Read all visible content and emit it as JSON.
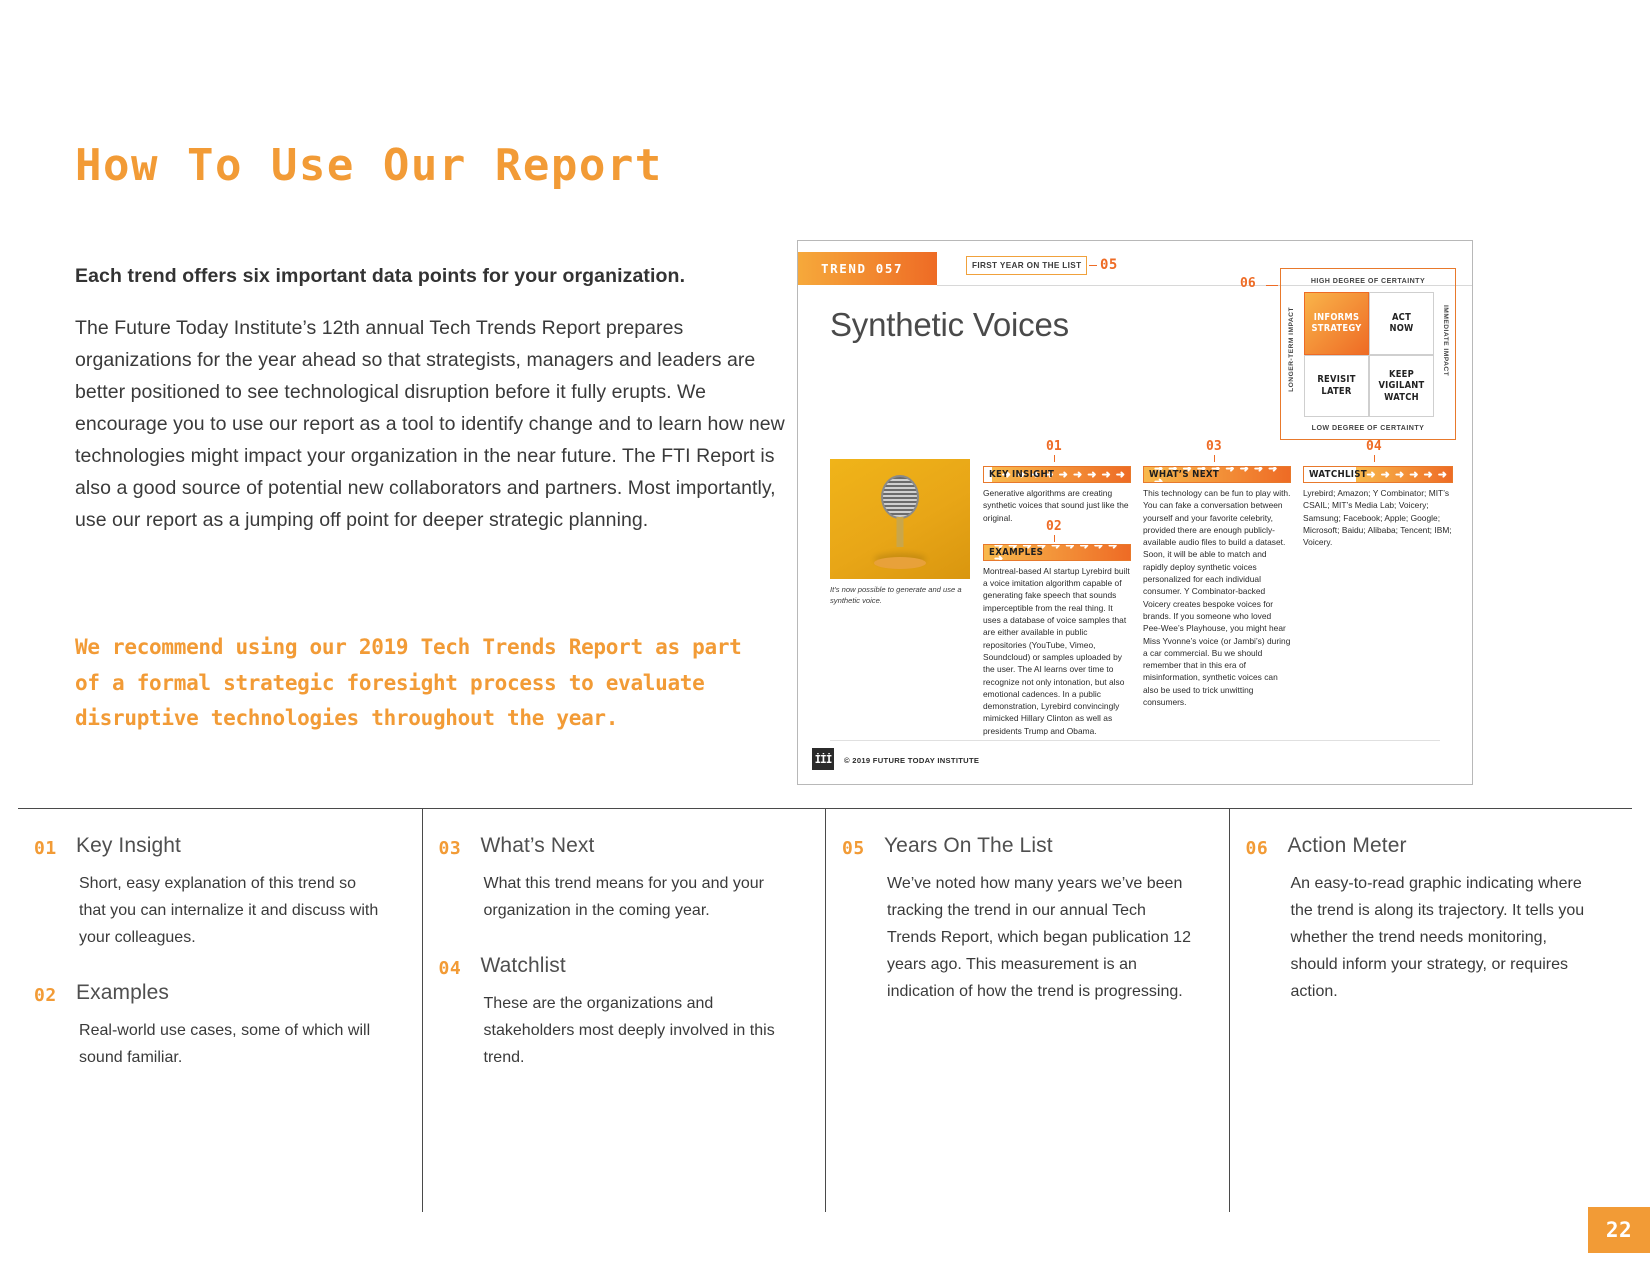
{
  "page": {
    "title": "How To Use Our Report",
    "number": "22",
    "accent_orange": "#F29B36",
    "accent_deep_orange": "#EE6B25"
  },
  "intro": {
    "lead": "Each trend offers six important data points for your organization.",
    "body": "The Future Today Institute’s 12th annual Tech Trends Report prepares organizations for the year ahead so that strategists, managers and leaders are better positioned to see technological disruption before it fully erupts. We encourage you to use our report as a tool to identify change and to learn how new technologies might impact your organization in the near future. The FTI Report is also a good source of potential new collaborators and partners. Most importantly, use our report as a jumping off point for deeper strategic planning.",
    "recommendation": "We recommend using our 2019 Tech Trends Report as part of a formal strategic foresight process to evaluate disruptive technologies throughout the year."
  },
  "inset": {
    "trend_badge": "TREND 057",
    "first_year_label": "FIRST YEAR ON THE LIST",
    "first_year_value": "05",
    "trend_title": "Synthetic Voices",
    "photo_caption": "It’s now possible to generate and use a synthetic voice.",
    "copyright": "© 2019 FUTURE TODAY INSTITUTE",
    "logo_glyph": "İİİ",
    "action_meter": {
      "callout_number": "06",
      "top_label": "HIGH DEGREE OF CERTAINTY",
      "bottom_label": "LOW DEGREE OF CERTAINTY",
      "left_label": "LONGER-TERM IMPACT",
      "right_label": "IMMEDIATE IMPACT",
      "cells": [
        {
          "label": "INFORMS\nSTRATEGY",
          "line1": "INFORMS",
          "line2": "STRATEGY",
          "active": true
        },
        {
          "label": "ACT NOW",
          "line1": "ACT",
          "line2": "NOW",
          "active": false
        },
        {
          "label": "REVISIT LATER",
          "line1": "REVISIT",
          "line2": "LATER",
          "active": false
        },
        {
          "label": "KEEP VIGILANT WATCH",
          "line1": "KEEP",
          "line2": "VIGILANT",
          "line3": "WATCH",
          "active": false
        }
      ]
    },
    "sections": [
      {
        "number": "01",
        "heading": "KEY INSIGHT",
        "arrows": "➜ ➜ ➜ ➜ ➜ ➜ ➜ ➜ ➜",
        "body": "Generative algorithms are creating synthetic voices that sound just like the original."
      },
      {
        "number": "02",
        "heading": "EXAMPLES",
        "arrows": "➜ ➜ ➜ ➜ ➜ ➜ ➜ ➜ ➜ ➜",
        "body": "Montreal-based AI startup Lyrebird built a voice imitation algorithm capable of generating fake speech that sounds imperceptible from the real thing. It uses a database of voice samples that are either available in public repositories (YouTube, Vimeo, Soundcloud) or samples uploaded by the user. The AI learns over time to recognize not only intonation, but also emotional cadences. In a public demonstration, Lyrebird convincingly mimicked Hillary Clinton as well as presidents Trump and Obama."
      },
      {
        "number": "03",
        "heading": "WHAT’S NEXT",
        "arrows": "➜ ➜ ➜ ➜ ➜ ➜ ➜ ➜ ➜ ➜",
        "body": "This technology can be fun to play with. You can fake a conversation between yourself and your favorite celebrity, provided there are enough publicly-available audio files to build a dataset. Soon, it will be able to match and rapidly deploy synthetic voices personalized for each individual consumer. Y Combinator-backed Voicery creates bespoke voices for brands. If you someone who loved Pee-Wee’s Playhouse, you might hear Miss Yvonne’s voice (or Jambi’s) during a car commercial. Bu we should remember that in this era of misinformation, synthetic voices can also be used to trick unwitting consumers."
      },
      {
        "number": "04",
        "heading": "WATCHLIST",
        "arrows": "➜ ➜ ➜ ➜ ➜ ➜",
        "body": "Lyrebird; Amazon; Y Combinator; MIT’s CSAIL; MIT’s Media Lab; Voicery; Samsung; Facebook; Apple; Google; Microsoft; Baidu; Alibaba; Tencent; IBM; Voicery."
      }
    ]
  },
  "legend": {
    "columns": [
      {
        "items": [
          {
            "number": "01",
            "title": "Key Insight",
            "desc": "Short, easy explanation of this trend so that you can internalize it and discuss with your colleagues."
          },
          {
            "number": "02",
            "title": "Examples",
            "desc": "Real-world use cases, some of which will sound familiar."
          }
        ]
      },
      {
        "items": [
          {
            "number": "03",
            "title": "What’s Next",
            "desc": "What this trend means for you and your organization in the coming year."
          },
          {
            "number": "04",
            "title": "Watchlist",
            "desc": "These are the organizations and stakeholders most deeply involved in this trend."
          }
        ]
      },
      {
        "items": [
          {
            "number": "05",
            "title": "Years On The List",
            "desc": "We’ve noted how many years we’ve been tracking the trend in our annual Tech Trends Report, which began publication 12 years ago. This measurement is an indication of how the trend is progressing."
          }
        ]
      },
      {
        "items": [
          {
            "number": "06",
            "title": "Action Meter",
            "desc": "An easy-to-read graphic indicating where the trend is along its trajectory. It tells you whether the trend needs monitoring, should inform your strategy, or requires action."
          }
        ]
      }
    ]
  }
}
